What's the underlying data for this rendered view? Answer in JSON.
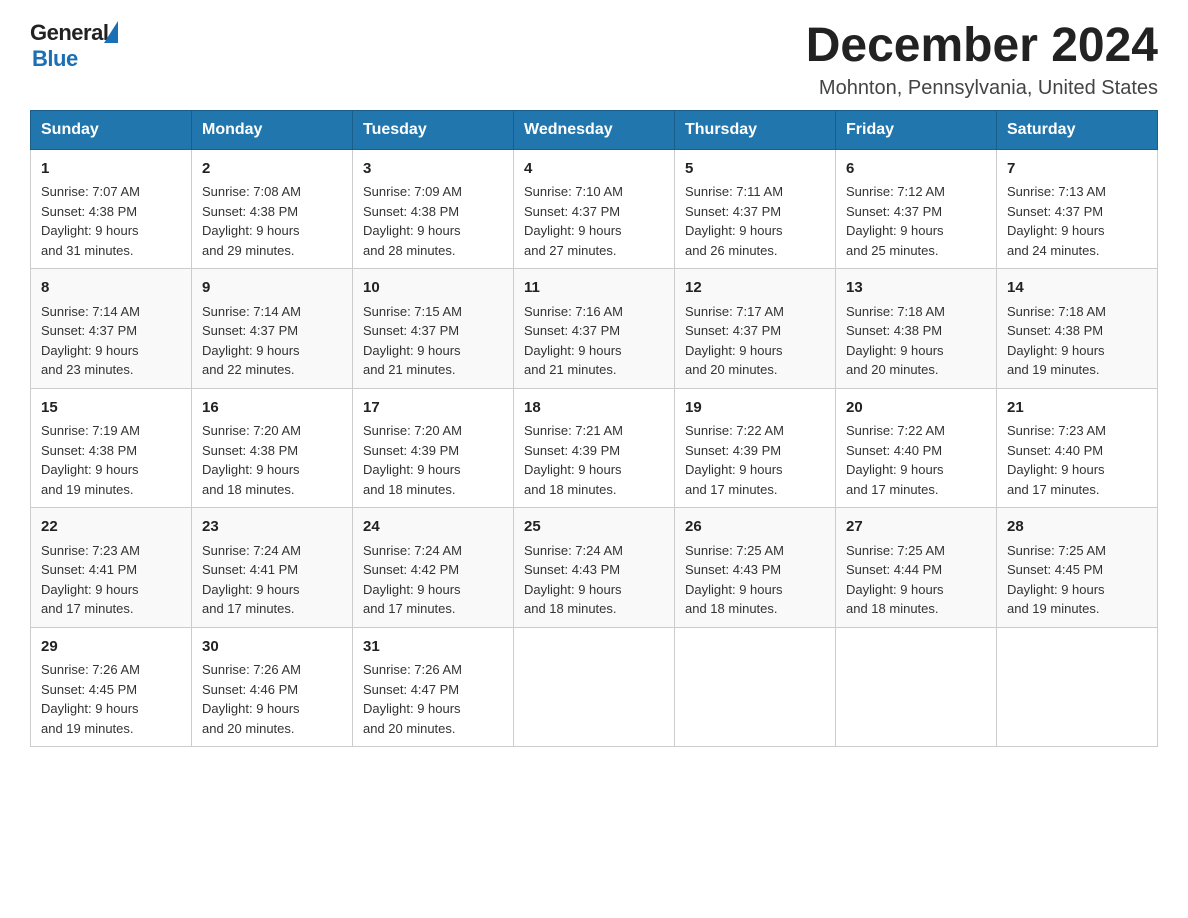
{
  "header": {
    "logo_general": "General",
    "logo_blue": "Blue",
    "month_title": "December 2024",
    "location": "Mohnton, Pennsylvania, United States"
  },
  "weekdays": [
    "Sunday",
    "Monday",
    "Tuesday",
    "Wednesday",
    "Thursday",
    "Friday",
    "Saturday"
  ],
  "weeks": [
    [
      {
        "day": "1",
        "sunrise": "7:07 AM",
        "sunset": "4:38 PM",
        "daylight": "9 hours and 31 minutes."
      },
      {
        "day": "2",
        "sunrise": "7:08 AM",
        "sunset": "4:38 PM",
        "daylight": "9 hours and 29 minutes."
      },
      {
        "day": "3",
        "sunrise": "7:09 AM",
        "sunset": "4:38 PM",
        "daylight": "9 hours and 28 minutes."
      },
      {
        "day": "4",
        "sunrise": "7:10 AM",
        "sunset": "4:37 PM",
        "daylight": "9 hours and 27 minutes."
      },
      {
        "day": "5",
        "sunrise": "7:11 AM",
        "sunset": "4:37 PM",
        "daylight": "9 hours and 26 minutes."
      },
      {
        "day": "6",
        "sunrise": "7:12 AM",
        "sunset": "4:37 PM",
        "daylight": "9 hours and 25 minutes."
      },
      {
        "day": "7",
        "sunrise": "7:13 AM",
        "sunset": "4:37 PM",
        "daylight": "9 hours and 24 minutes."
      }
    ],
    [
      {
        "day": "8",
        "sunrise": "7:14 AM",
        "sunset": "4:37 PM",
        "daylight": "9 hours and 23 minutes."
      },
      {
        "day": "9",
        "sunrise": "7:14 AM",
        "sunset": "4:37 PM",
        "daylight": "9 hours and 22 minutes."
      },
      {
        "day": "10",
        "sunrise": "7:15 AM",
        "sunset": "4:37 PM",
        "daylight": "9 hours and 21 minutes."
      },
      {
        "day": "11",
        "sunrise": "7:16 AM",
        "sunset": "4:37 PM",
        "daylight": "9 hours and 21 minutes."
      },
      {
        "day": "12",
        "sunrise": "7:17 AM",
        "sunset": "4:37 PM",
        "daylight": "9 hours and 20 minutes."
      },
      {
        "day": "13",
        "sunrise": "7:18 AM",
        "sunset": "4:38 PM",
        "daylight": "9 hours and 20 minutes."
      },
      {
        "day": "14",
        "sunrise": "7:18 AM",
        "sunset": "4:38 PM",
        "daylight": "9 hours and 19 minutes."
      }
    ],
    [
      {
        "day": "15",
        "sunrise": "7:19 AM",
        "sunset": "4:38 PM",
        "daylight": "9 hours and 19 minutes."
      },
      {
        "day": "16",
        "sunrise": "7:20 AM",
        "sunset": "4:38 PM",
        "daylight": "9 hours and 18 minutes."
      },
      {
        "day": "17",
        "sunrise": "7:20 AM",
        "sunset": "4:39 PM",
        "daylight": "9 hours and 18 minutes."
      },
      {
        "day": "18",
        "sunrise": "7:21 AM",
        "sunset": "4:39 PM",
        "daylight": "9 hours and 18 minutes."
      },
      {
        "day": "19",
        "sunrise": "7:22 AM",
        "sunset": "4:39 PM",
        "daylight": "9 hours and 17 minutes."
      },
      {
        "day": "20",
        "sunrise": "7:22 AM",
        "sunset": "4:40 PM",
        "daylight": "9 hours and 17 minutes."
      },
      {
        "day": "21",
        "sunrise": "7:23 AM",
        "sunset": "4:40 PM",
        "daylight": "9 hours and 17 minutes."
      }
    ],
    [
      {
        "day": "22",
        "sunrise": "7:23 AM",
        "sunset": "4:41 PM",
        "daylight": "9 hours and 17 minutes."
      },
      {
        "day": "23",
        "sunrise": "7:24 AM",
        "sunset": "4:41 PM",
        "daylight": "9 hours and 17 minutes."
      },
      {
        "day": "24",
        "sunrise": "7:24 AM",
        "sunset": "4:42 PM",
        "daylight": "9 hours and 17 minutes."
      },
      {
        "day": "25",
        "sunrise": "7:24 AM",
        "sunset": "4:43 PM",
        "daylight": "9 hours and 18 minutes."
      },
      {
        "day": "26",
        "sunrise": "7:25 AM",
        "sunset": "4:43 PM",
        "daylight": "9 hours and 18 minutes."
      },
      {
        "day": "27",
        "sunrise": "7:25 AM",
        "sunset": "4:44 PM",
        "daylight": "9 hours and 18 minutes."
      },
      {
        "day": "28",
        "sunrise": "7:25 AM",
        "sunset": "4:45 PM",
        "daylight": "9 hours and 19 minutes."
      }
    ],
    [
      {
        "day": "29",
        "sunrise": "7:26 AM",
        "sunset": "4:45 PM",
        "daylight": "9 hours and 19 minutes."
      },
      {
        "day": "30",
        "sunrise": "7:26 AM",
        "sunset": "4:46 PM",
        "daylight": "9 hours and 20 minutes."
      },
      {
        "day": "31",
        "sunrise": "7:26 AM",
        "sunset": "4:47 PM",
        "daylight": "9 hours and 20 minutes."
      },
      null,
      null,
      null,
      null
    ]
  ]
}
